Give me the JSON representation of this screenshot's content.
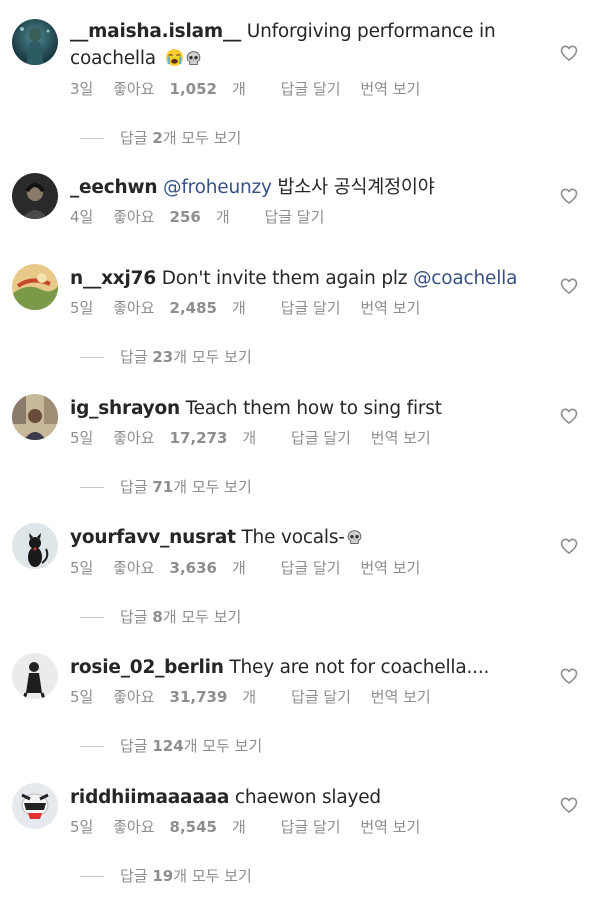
{
  "labels": {
    "likes_prefix": "좋아요 ",
    "likes_suffix": "개",
    "reply": "답글 달기",
    "translate": "번역 보기",
    "replies_prefix": "답글 ",
    "replies_suffix": "개 모두 보기"
  },
  "comments": [
    {
      "username": "__maisha.islam__",
      "text": " Unforgiving performance in coachella",
      "emojis": [
        "loudly-crying-face-icon",
        "skull-icon"
      ],
      "time": "3일",
      "likes": "1,052",
      "translate": true,
      "replies": "2"
    },
    {
      "username": "_eechwn",
      "mention": " @froheunzy",
      "text": " 밥소사 공식계정이야",
      "time": "4일",
      "likes": "256",
      "translate": false,
      "replies": null
    },
    {
      "username": "n__xxj76",
      "text": " Don't invite them again plz ",
      "mention_after": "@coachella",
      "time": "5일",
      "likes": "2,485",
      "translate": true,
      "replies": "23"
    },
    {
      "username": "ig_shrayon",
      "text": " Teach them how to sing first",
      "time": "5일",
      "likes": "17,273",
      "translate": true,
      "replies": "71"
    },
    {
      "username": "yourfavv_nusrat",
      "text": " The vocals-",
      "emojis": [
        "skull-icon"
      ],
      "time": "5일",
      "likes": "3,636",
      "translate": true,
      "replies": "8"
    },
    {
      "username": "rosie_02_berlin",
      "text": " They are not for coachella....",
      "time": "5일",
      "likes": "31,739",
      "translate": true,
      "replies": "124"
    },
    {
      "username": "riddhiimaaaaaa",
      "text": " chaewon slayed",
      "time": "5일",
      "likes": "8,545",
      "translate": true,
      "replies": "19"
    }
  ]
}
